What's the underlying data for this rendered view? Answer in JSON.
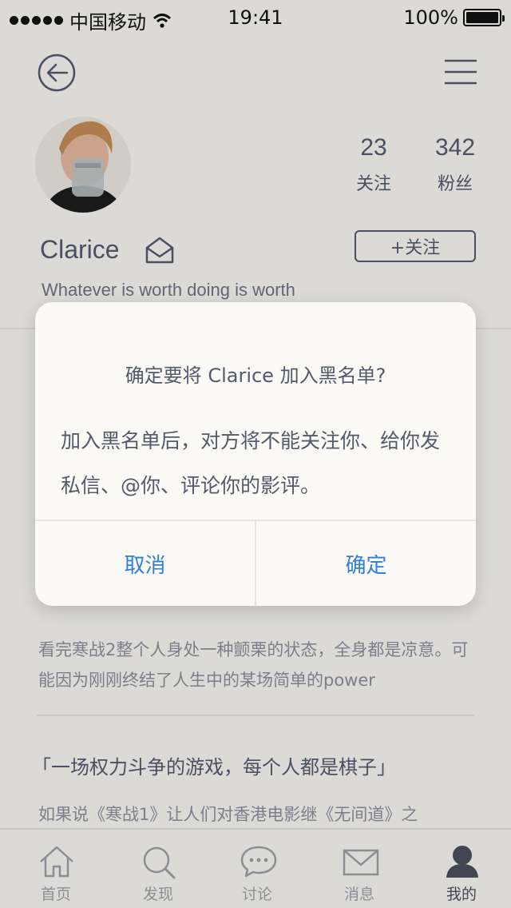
{
  "status": {
    "carrier": "中国移动",
    "time": "19:41",
    "battery": "100%"
  },
  "profile": {
    "name": "Clarice",
    "bio": "Whatever is worth doing is worth",
    "following_count": "23",
    "following_label": "关注",
    "followers_count": "342",
    "followers_label": "粉丝",
    "follow_button": "+关注"
  },
  "reviews": [
    {
      "title": "",
      "body": "看完寒战2整个人身处一种颤栗的状态，全身都是凉意。可能因为刚刚终结了人生中的某场简单的power"
    },
    {
      "title": "「一场权力斗争的游戏，每个人都是棋子」",
      "body": "如果说《寒战1》让人们对香港电影继《无间道》之"
    }
  ],
  "dialog": {
    "title": "确定要将 Clarice 加入黑名单?",
    "message": "加入黑名单后，对方将不能关注你、给你发私信、@你、评论你的影评。",
    "cancel": "取消",
    "confirm": "确定"
  },
  "tabs": [
    {
      "label": "首页",
      "icon": "home-icon"
    },
    {
      "label": "发现",
      "icon": "search-icon"
    },
    {
      "label": "讨论",
      "icon": "chat-icon"
    },
    {
      "label": "消息",
      "icon": "mail-icon"
    },
    {
      "label": "我的",
      "icon": "user-icon",
      "active": true
    }
  ],
  "colors": {
    "accent": "#2f7fdb",
    "text": "#535a6b",
    "background": "#f4f3ef"
  }
}
